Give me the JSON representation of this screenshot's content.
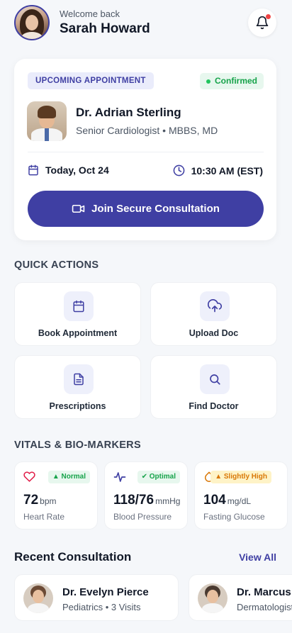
{
  "user": {
    "welcome": "Welcome back",
    "name": "Sarah Howard"
  },
  "appointment": {
    "tag": "UPCOMING APPOINTMENT",
    "status": "Confirmed",
    "doctor_name": "Dr. Adrian Sterling",
    "specialty": "Senior Cardiologist • MBBS, MD",
    "date": "Today, Oct 24",
    "time": "10:30 AM (EST)",
    "join_label": "Join Secure Consultation"
  },
  "quick_actions": {
    "title": "QUICK ACTIONS",
    "items": [
      {
        "label": "Book Appointment",
        "icon": "calendar-icon"
      },
      {
        "label": "Upload Doc",
        "icon": "cloud-upload-icon"
      },
      {
        "label": "Prescriptions",
        "icon": "document-icon"
      },
      {
        "label": "Find Doctor",
        "icon": "search-icon"
      }
    ]
  },
  "vitals": {
    "title": "VITALS & BIO-MARKERS",
    "items": [
      {
        "badge": "Normal",
        "value": "72",
        "unit": "bpm",
        "caption": "Heart Rate",
        "icon": "heart-icon"
      },
      {
        "badge": "Optimal",
        "value": "118/76",
        "unit": "mmHg",
        "caption": "Blood Pressure",
        "icon": "pulse-icon"
      },
      {
        "badge": "Slightly High",
        "value": "104",
        "unit": "mg/dL",
        "caption": "Fasting Glucose",
        "icon": "droplet-icon"
      }
    ]
  },
  "recent": {
    "title": "Recent Consultation",
    "view_all": "View All",
    "items": [
      {
        "name": "Dr. Evelyn Pierce",
        "sub": "Pediatrics • 3 Visits"
      },
      {
        "name": "Dr. Marcus",
        "sub": "Dermatologist"
      }
    ]
  },
  "colors": {
    "primary": "#3F3FA3",
    "success": "#16A34A",
    "warning": "#D97706",
    "alert": "#EF4444"
  }
}
